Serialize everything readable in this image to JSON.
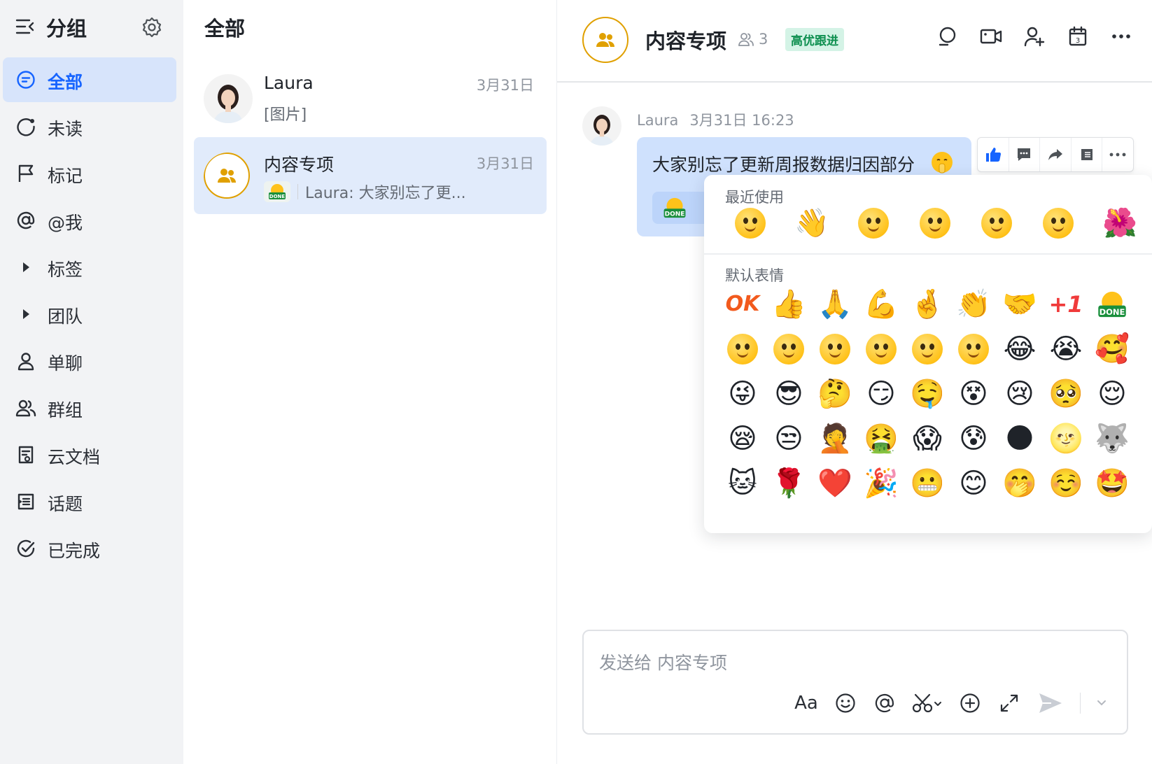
{
  "sidebar": {
    "title": "分组",
    "items": [
      {
        "label": "全部",
        "icon": "chat-icon",
        "active": true
      },
      {
        "label": "未读",
        "icon": "unread-icon"
      },
      {
        "label": "标记",
        "icon": "flag-icon"
      },
      {
        "label": "@我",
        "icon": "at-icon"
      },
      {
        "label": "标签",
        "icon": "caret-right-icon"
      },
      {
        "label": "团队",
        "icon": "caret-right-icon"
      },
      {
        "label": "单聊",
        "icon": "person-icon"
      },
      {
        "label": "群组",
        "icon": "group-icon"
      },
      {
        "label": "云文档",
        "icon": "doc-icon"
      },
      {
        "label": "话题",
        "icon": "topic-icon"
      },
      {
        "label": "已完成",
        "icon": "check-circle-icon"
      }
    ]
  },
  "conversations": {
    "header": "全部",
    "items": [
      {
        "name": "Laura",
        "time": "3月31日",
        "preview": "[图片]"
      },
      {
        "name": "内容专项",
        "time": "3月31日",
        "preview": "Laura: 大家别忘了更..."
      }
    ]
  },
  "chat": {
    "title": "内容专项",
    "member_count": "3",
    "tag": "高优跟进",
    "message": {
      "sender": "Laura",
      "timestamp": "3月31日 16:23",
      "text": "大家别忘了更新周报数据归因部分"
    },
    "picker": {
      "recent_label": "最近使用",
      "default_label": "默认表情",
      "ok_text": "OK",
      "plus_one_text": "+1",
      "done_text": "DONE"
    },
    "composer": {
      "placeholder": "发送给 内容专项",
      "format_label": "Aa"
    }
  },
  "colors": {
    "accent": "#1664ff",
    "sidebar_bg": "#f2f3f5",
    "active_bg": "#d7e4fb",
    "bubble_bg": "#cfe1fd",
    "tag_bg": "#d4f3e6",
    "tag_text": "#0d8f4f",
    "group_ring": "#e0a000"
  }
}
